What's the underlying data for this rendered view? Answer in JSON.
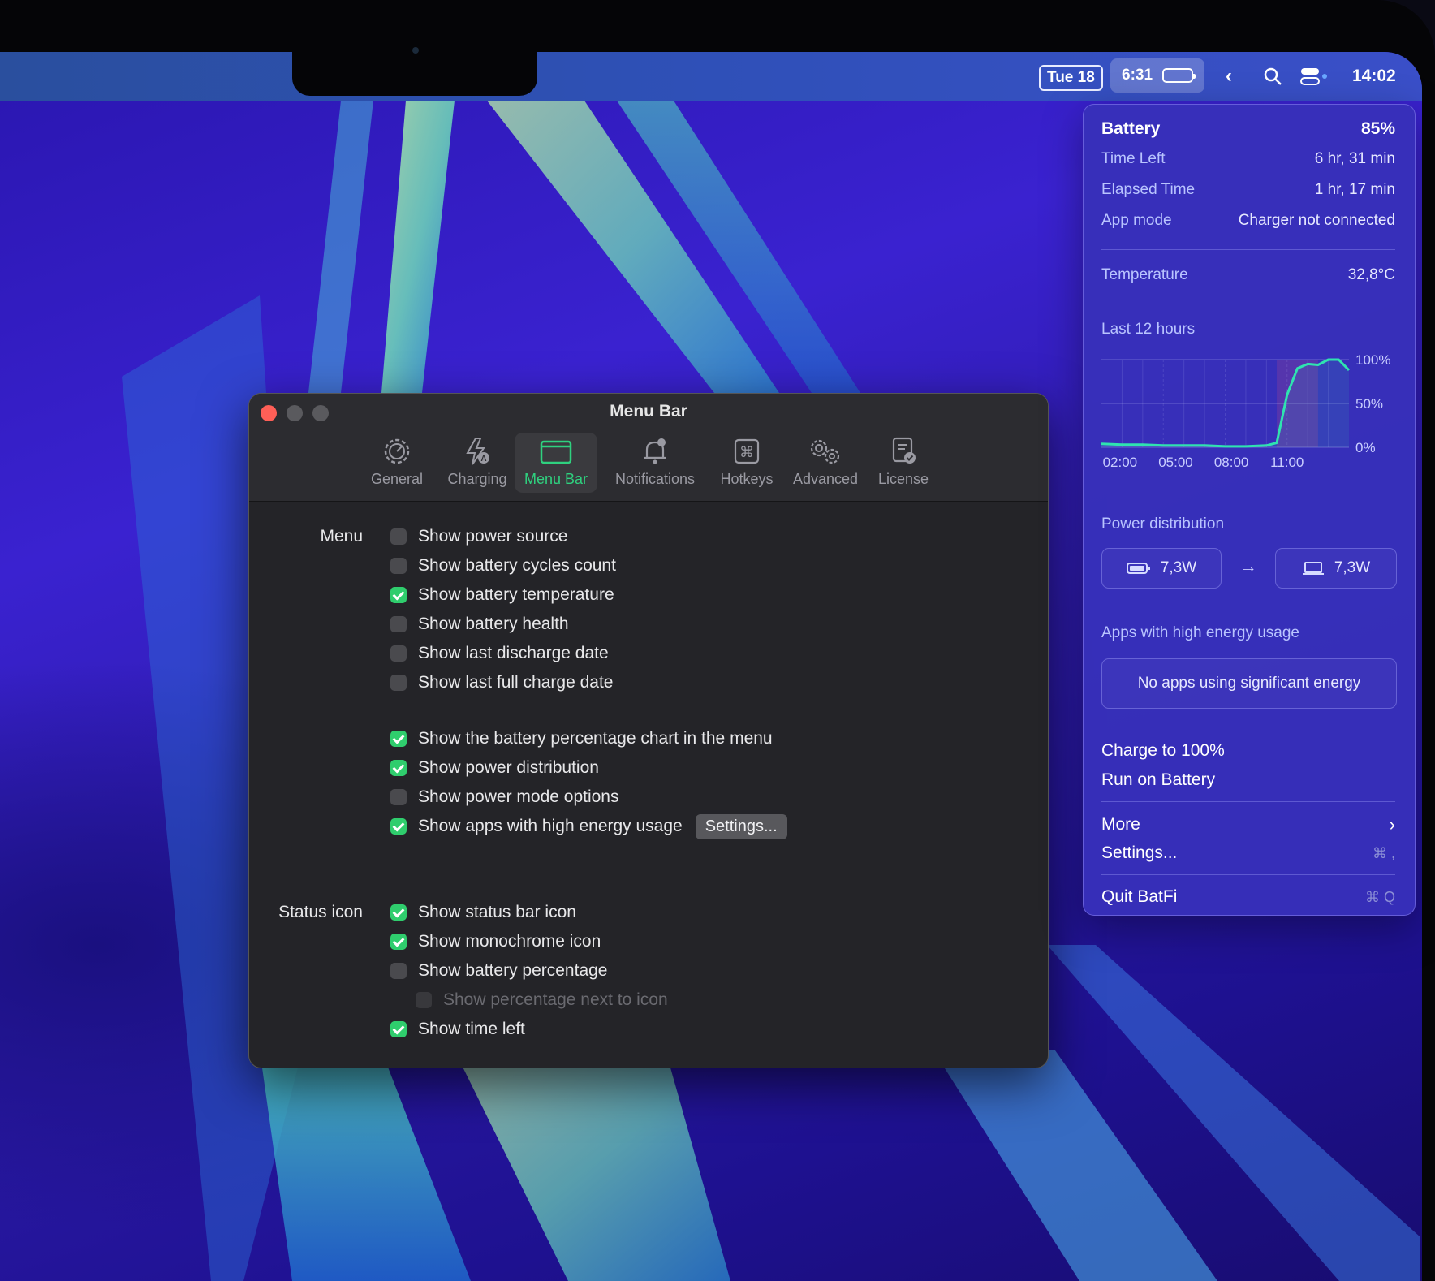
{
  "menubar": {
    "date": "Tue 18",
    "battery_time": "6:31",
    "clock": "14:02",
    "icons": [
      "chevron-left-icon",
      "search-icon",
      "control-center-icon"
    ]
  },
  "window": {
    "title": "Menu Bar",
    "tabs": [
      {
        "label": "General",
        "icon": "gear-icon",
        "active": false
      },
      {
        "label": "Charging",
        "icon": "bolt-icon",
        "active": false
      },
      {
        "label": "Menu Bar",
        "icon": "menubar-icon",
        "active": true
      },
      {
        "label": "Notifications",
        "icon": "bell-icon",
        "active": false
      },
      {
        "label": "Hotkeys",
        "icon": "command-key-icon",
        "active": false
      },
      {
        "label": "Advanced",
        "icon": "gears-icon",
        "active": false
      },
      {
        "label": "License",
        "icon": "license-icon",
        "active": false
      }
    ],
    "menu_section_label": "Menu",
    "menu_options": [
      {
        "label": "Show power source",
        "checked": false
      },
      {
        "label": "Show battery cycles count",
        "checked": false
      },
      {
        "label": "Show battery temperature",
        "checked": true
      },
      {
        "label": "Show battery health",
        "checked": false
      },
      {
        "label": "Show last discharge date",
        "checked": false
      },
      {
        "label": "Show last full charge date",
        "checked": false
      },
      {
        "label": "Show the battery percentage chart in the menu",
        "checked": true
      },
      {
        "label": "Show power distribution",
        "checked": true
      },
      {
        "label": "Show power mode options",
        "checked": false
      },
      {
        "label": "Show apps with high energy usage",
        "checked": true
      }
    ],
    "settings_button": "Settings...",
    "status_section_label": "Status icon",
    "status_options": [
      {
        "label": "Show status bar icon",
        "checked": true
      },
      {
        "label": "Show monochrome icon",
        "checked": true
      },
      {
        "label": "Show battery percentage",
        "checked": false
      },
      {
        "label": "Show percentage next to icon",
        "checked": false,
        "disabled": true
      },
      {
        "label": "Show time left",
        "checked": true
      }
    ],
    "accent_color": "#2fcd6d"
  },
  "popover": {
    "title": "Battery",
    "percent": "85%",
    "time_left_label": "Time Left",
    "time_left_value": "6 hr, 31 min",
    "elapsed_label": "Elapsed Time",
    "elapsed_value": "1 hr, 17 min",
    "app_mode_label": "App mode",
    "app_mode_value": "Charger not connected",
    "temperature_label": "Temperature",
    "temperature_value": "32,8°C",
    "chart_label": "Last 12 hours",
    "power_label": "Power distribution",
    "power_in": "7,3W",
    "power_out": "7,3W",
    "apps_label": "Apps with high energy usage",
    "apps_empty": "No apps using significant energy",
    "charge_action": "Charge to 100%",
    "battery_action": "Run on Battery",
    "more_action": "More",
    "settings_action": "Settings...",
    "settings_shortcut": "⌘ ,",
    "quit_action": "Quit BatFi",
    "quit_shortcut": "⌘ Q"
  },
  "chart_data": {
    "type": "line",
    "x_ticks": [
      "02:00",
      "05:00",
      "08:00",
      "11:00"
    ],
    "y_ticks": [
      "100%",
      "50%",
      "0%"
    ],
    "ylim": [
      0,
      100
    ],
    "x": [
      0,
      1,
      2,
      3,
      4,
      5,
      6,
      7,
      8,
      8.5,
      9,
      9.5,
      10,
      10.5,
      11,
      11.5,
      12
    ],
    "series": [
      {
        "values": [
          4,
          3,
          3,
          2,
          2,
          2,
          1,
          1,
          2,
          5,
          60,
          90,
          95,
          94,
          100,
          100,
          88
        ]
      }
    ],
    "line_color": "#2fe3b0",
    "charging_band_color": "#7a3fa0"
  }
}
